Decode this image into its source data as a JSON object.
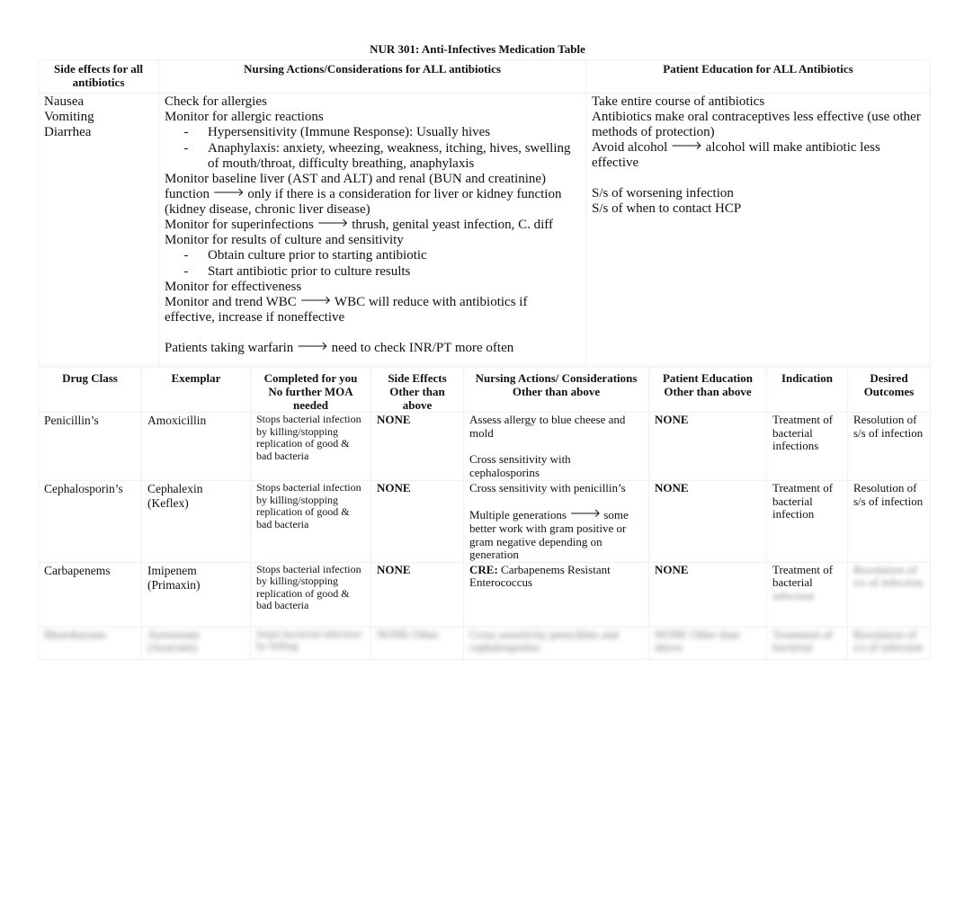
{
  "document": {
    "title": "NUR 301: Anti-Infectives Medication Table"
  },
  "general_table": {
    "headers": {
      "side_effects": "Side effects for all antibiotics",
      "nursing_actions": "Nursing Actions/Considerations for ALL antibiotics",
      "patient_education": "Patient Education for ALL Antibiotics"
    },
    "side_effects": [
      "Nausea",
      "Vomiting",
      "Diarrhea"
    ],
    "nursing_actions": {
      "l1": "Check for allergies",
      "l2": "Monitor for allergic reactions",
      "l2_sub1": "Hypersensitivity (Immune Response): Usually hives",
      "l2_sub2": "Anaphylaxis: anxiety, wheezing, weakness, itching, hives, swelling of mouth/throat, difficulty breathing, anaphylaxis",
      "l3a": "Monitor baseline liver (AST and ALT) and renal (BUN and creatinine) function",
      "l3b": "only if there is a consideration for liver or kidney function (kidney disease, chronic liver disease)",
      "l4a": "Monitor for superinfections",
      "l4b": "thrush, genital yeast infection, C. diff",
      "l5": "Monitor for results of culture and sensitivity",
      "l5_sub1": "Obtain culture prior to starting antibiotic",
      "l5_sub2": "Start antibiotic prior to culture results",
      "l6": "Monitor for effectiveness",
      "l7a": "Monitor and trend WBC",
      "l7b": "WBC will reduce with antibiotics if effective, increase if noneffective",
      "l8a": "Patients taking warfarin",
      "l8b": "need to check INR/PT more often",
      "dash": "-",
      "arrow": "🡒"
    },
    "patient_education": {
      "l1": "Take entire course of antibiotics",
      "l2": "Antibiotics make oral contraceptives less effective (use other methods of protection)",
      "l3a": "Avoid alcohol",
      "l3b": "alcohol will make antibiotic less effective",
      "l4": "S/s of worsening infection",
      "l5": "S/s of when to contact HCP"
    }
  },
  "drug_table": {
    "headers": {
      "drug_class": "Drug Class",
      "exemplar": "Exemplar",
      "moa": "Completed for you No further MOA needed",
      "side_effects": "Side Effects Other than above",
      "nursing": "Nursing Actions/ Considerations Other than above",
      "education": "Patient Education Other than above",
      "indication": "Indication",
      "outcomes": "Desired Outcomes"
    },
    "rows": [
      {
        "drug_class": "Penicillin’s",
        "exemplar": "Amoxicillin",
        "moa": "Stops bacterial infection by killing/stopping replication of good & bad bacteria",
        "side_effects": "NONE",
        "nursing_1": "Assess allergy to blue cheese and mold",
        "nursing_2": "Cross sensitivity with cephalosporins",
        "education": "NONE",
        "indication": "Treatment of bacterial infections",
        "outcomes": "Resolution of s/s of infection"
      },
      {
        "drug_class": "Cephalosporin’s",
        "exemplar": "Cephalexin (Keflex)",
        "moa": "Stops bacterial infection by killing/stopping replication of good & bad bacteria",
        "side_effects": "NONE",
        "nursing_1": "Cross sensitivity with penicillin’s",
        "nursing_2a": "Multiple generations",
        "nursing_2b": "some better work with gram positive or gram negative depending on generation",
        "education": "NONE",
        "indication": "Treatment of bacterial infection",
        "outcomes": "Resolution of s/s of infection"
      },
      {
        "drug_class": "Carbapenems",
        "exemplar": "Imipenem (Primaxin)",
        "moa": "Stops bacterial infection by killing/stopping replication of good & bad bacteria",
        "side_effects": "NONE",
        "nursing_label": "CRE:",
        "nursing_text": "Carbapenems Resistant Enterococcus",
        "education": "NONE",
        "indication_visible": "Treatment of bacterial",
        "indication_obscured": "infection",
        "outcomes_obscured": "Resolution of s/s of infection"
      },
      {
        "obscured": true,
        "drug_class": "Monobactam",
        "exemplar": "Aztreonam (Azactam)",
        "moa": "Stops bacterial infection by killing",
        "side_effects": "NONE Other",
        "nursing": "Cross sensitivity penicillins and cephalosporins",
        "education": "NONE Other than above",
        "indication": "Treatment of bacterial",
        "outcomes": "Resolution of s/s of infection"
      }
    ]
  }
}
